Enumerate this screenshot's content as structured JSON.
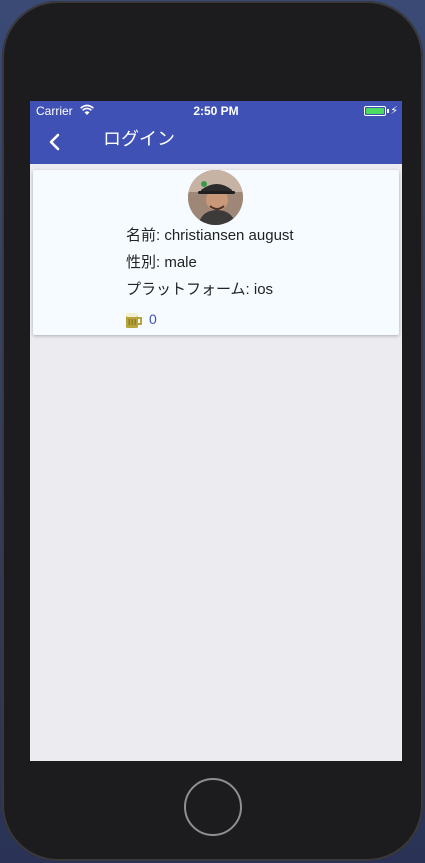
{
  "status_bar": {
    "carrier": "Carrier",
    "time": "2:50 PM",
    "wifi_icon": "wifi-icon",
    "battery_icon": "battery-icon",
    "battery_color": "#4cd964",
    "charging_symbol": "⚡"
  },
  "nav_bar": {
    "back_icon": "chevron-left-icon",
    "title": "ログイン",
    "background_color": "#3f51b5"
  },
  "profile": {
    "avatar_icon": "user-avatar-photo",
    "name_line": "名前: christiansen august",
    "gender_line": "性別: male",
    "platform_line": "プラットフォーム: ios",
    "like_icon": "beer-mug-icon",
    "like_count": "0"
  },
  "device": {
    "home_button": "home-button"
  }
}
